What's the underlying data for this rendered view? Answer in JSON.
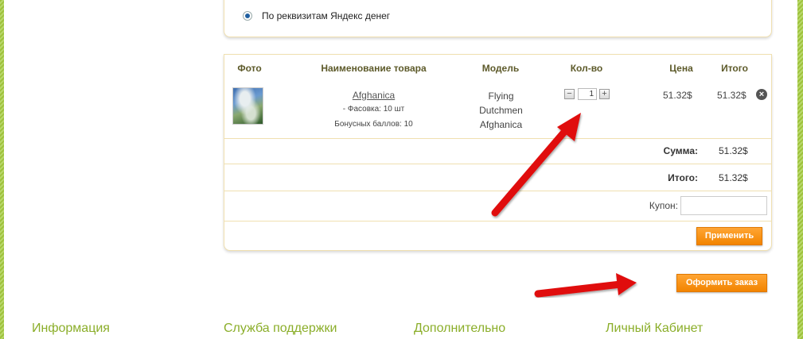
{
  "payment": {
    "option_label": "По реквизитам Яндекс денег"
  },
  "cart": {
    "headers": {
      "photo": "Фото",
      "name": "Наименование товара",
      "model": "Модель",
      "qty": "Кол-во",
      "price": "Цена",
      "total": "Итого"
    },
    "item": {
      "name": "Afghanica",
      "packaging": "- Фасовка: 10 шт",
      "bonus": "Бонусных баллов: 10",
      "model_line1": "Flying",
      "model_line2": "Dutchmen",
      "model_line3": "Afghanica",
      "qty": "1",
      "qty_minus": "−",
      "qty_plus": "+",
      "price": "51.32$",
      "total": "51.32$",
      "remove_icon": "×"
    },
    "summary": {
      "subtotal_label": "Сумма:",
      "subtotal_value": "51.32$",
      "total_label": "Итого:",
      "total_value": "51.32$"
    },
    "coupon": {
      "label": "Купон:",
      "value": "",
      "apply_label": "Применить"
    }
  },
  "checkout_label": "Оформить заказ",
  "footer": {
    "col1": "Информация",
    "col2": "Служба поддержки",
    "col3": "Дополнительно",
    "col4": "Личный Кабинет"
  },
  "colors": {
    "accent_orange": "#f28400",
    "footer_green": "#8bae2a",
    "header_olive": "#5d5a2a",
    "arrow_red": "#e01010"
  },
  "icons": {
    "remove": "close-circle-icon",
    "minus": "minus-icon",
    "plus": "plus-icon",
    "radio": "radio-selected-icon"
  }
}
